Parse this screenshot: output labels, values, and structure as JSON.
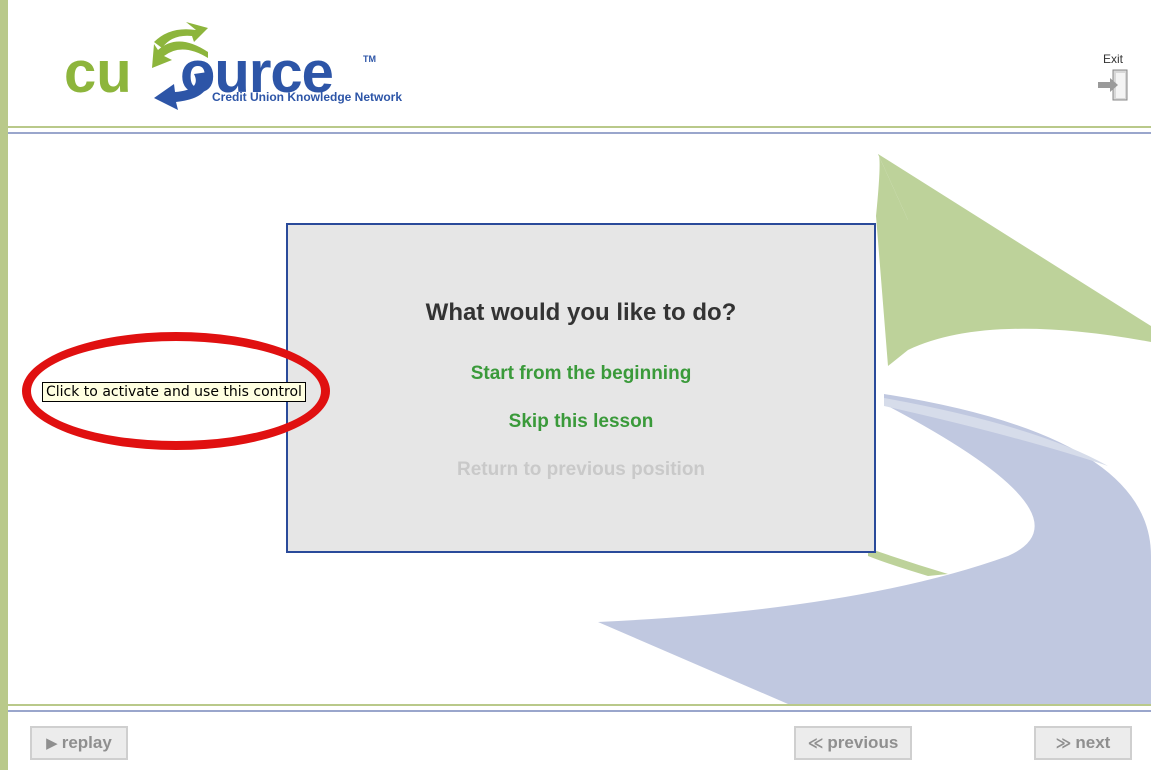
{
  "header": {
    "logo": {
      "brand_cu": "cu",
      "brand_source": "ource",
      "trademark": "TM",
      "tagline": "Credit Union Knowledge Network"
    },
    "exit_label": "Exit"
  },
  "dialog": {
    "title": "What would you like to do?",
    "options": [
      {
        "label": "Start from the beginning",
        "enabled": true
      },
      {
        "label": "Skip this lesson",
        "enabled": true
      },
      {
        "label": "Return to previous position",
        "enabled": false
      }
    ]
  },
  "tooltip": {
    "text": "Click to activate and use this control"
  },
  "footer": {
    "replay": {
      "glyph": "▶",
      "label": "replay"
    },
    "previous": {
      "glyph": "≪",
      "label": "previous"
    },
    "next": {
      "glyph": "≫",
      "label": "next"
    }
  },
  "colors": {
    "brand_green": "#8db53c",
    "brand_blue": "#2d55a7",
    "option_green": "#3a9a3a",
    "disabled_text": "#c9c9c9",
    "highlight_red": "#e01010"
  }
}
